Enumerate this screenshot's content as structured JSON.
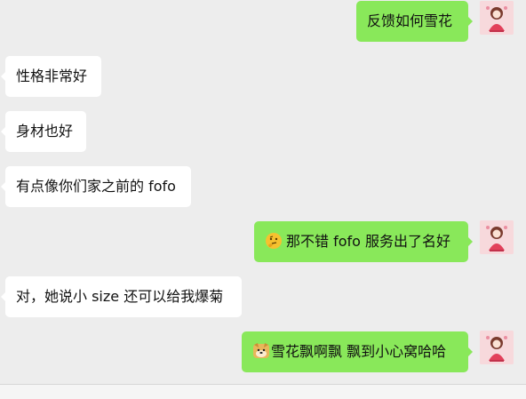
{
  "messages": [
    {
      "side": "out",
      "text": "反馈如何雪花"
    },
    {
      "side": "in",
      "text": "性格非常好"
    },
    {
      "side": "in",
      "text": "身材也好"
    },
    {
      "side": "in",
      "text": "有点像你们家之前的 fofo"
    },
    {
      "side": "out",
      "emoji": "thinking-face-emoji",
      "text": "那不错 fofo 服务出了名好"
    },
    {
      "side": "in",
      "text": "对，她说小 size 还可以给我爆菊"
    },
    {
      "side": "out",
      "emoji": "doge-emoji",
      "text": "雪花飘啊飘 飘到小心窝哈哈"
    }
  ],
  "colors": {
    "background": "#ededed",
    "incoming_bubble": "#ffffff",
    "outgoing_bubble": "#89e85a",
    "avatar_bg": "#f7d9dc"
  },
  "icons": {
    "self_avatar": "girl-avatar-icon"
  }
}
